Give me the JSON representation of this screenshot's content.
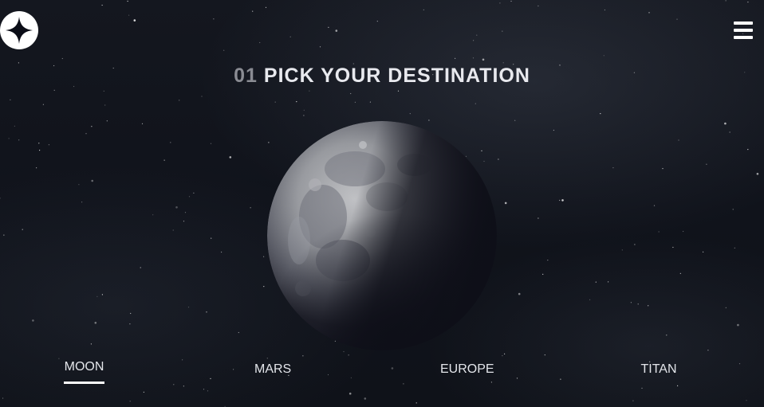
{
  "header": {
    "logo_icon": "star-logo-icon",
    "menu_icon": "hamburger-menu-icon"
  },
  "page": {
    "step_number": "01",
    "title": "PICK YOUR DESTINATION"
  },
  "planet": {
    "name": "MOON",
    "image_icon": "moon-image"
  },
  "destinations": [
    {
      "label": "MOON",
      "active": true
    },
    {
      "label": "MARS",
      "active": false
    },
    {
      "label": "EUROPE",
      "active": false
    },
    {
      "label": "TITAN",
      "active": false
    }
  ],
  "colors": {
    "background": "#0b0d17",
    "text": "#ffffff",
    "step_number": "#8a8c93"
  }
}
